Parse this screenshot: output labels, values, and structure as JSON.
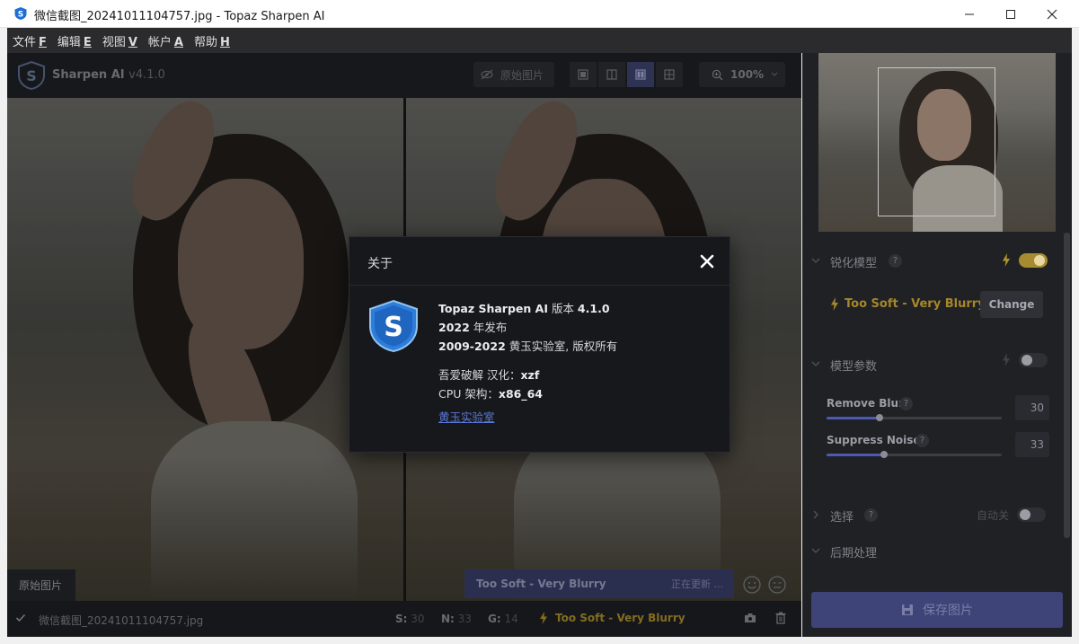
{
  "window": {
    "title": "微信截图_20241011104757.jpg - Topaz Sharpen AI",
    "controls": [
      "minimize",
      "maximize",
      "close"
    ]
  },
  "menu": [
    {
      "label": "文件",
      "key": "F"
    },
    {
      "label": "编辑",
      "key": "E"
    },
    {
      "label": "视图",
      "key": "V"
    },
    {
      "label": "帐户",
      "key": "A"
    },
    {
      "label": "帮助",
      "key": "H"
    }
  ],
  "toolbar": {
    "brand": "Sharpen AI",
    "version": "v4.1.0",
    "original_image_button": "原始图片",
    "zoom": "100%",
    "view_modes": [
      "single",
      "split",
      "side-by-side",
      "quad"
    ],
    "active_view": "side-by-side"
  },
  "preview": {
    "original_label": "原始图片",
    "model_strip": "Too Soft - Very Blurry",
    "updating_text": "正在更新 ..."
  },
  "statusbar": {
    "filename": "微信截图_20241011104757.jpg",
    "s_label": "S:",
    "s_value": "30",
    "n_label": "N:",
    "n_value": "33",
    "g_label": "G:",
    "g_value": "14",
    "model": "Too Soft - Very Blurry"
  },
  "right_panel": {
    "sharpen_model": {
      "title": "锐化模型",
      "help": "?",
      "enabled": true
    },
    "current_model": "Too Soft - Very Blurry",
    "change_button": "Change",
    "model_params": {
      "title": "模型参数",
      "help": "?",
      "enabled": false
    },
    "params": [
      {
        "label": "Remove Blur",
        "help": "?",
        "value": "30",
        "fraction": 0.3
      },
      {
        "label": "Suppress Noise",
        "help": "?",
        "value": "33",
        "fraction": 0.33
      }
    ],
    "selection": {
      "title": "选择",
      "help": "?",
      "auto_label": "自动关",
      "enabled": false
    },
    "post_processing": {
      "title": "后期处理"
    },
    "save_button": "保存图片"
  },
  "about_dialog": {
    "title": "关于",
    "line1_name": "Topaz Sharpen AI",
    "line1_mid": " 版本 ",
    "line1_ver": "4.1.0",
    "line2_year": "2022",
    "line2_rest": " 年发布",
    "line3_years": "2009-2022",
    "line3_rest": " 黄玉实验室, 版权所有",
    "line4_label": "吾爱破解 汉化：",
    "line4_value": "xzf",
    "line5_label": "CPU 架构：",
    "line5_value": "x86_64",
    "link": "黄玉实验室"
  },
  "colors": {
    "accent": "#3e4378",
    "model_gold": "#b3942a",
    "link": "#5a78d8"
  }
}
